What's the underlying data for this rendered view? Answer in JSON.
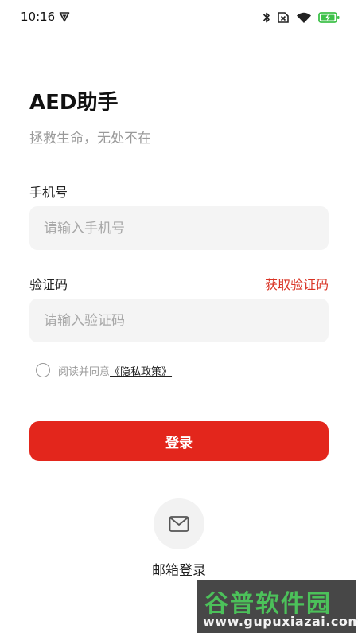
{
  "status_bar": {
    "time": "10:16",
    "icons": [
      "app-shield-icon",
      "bluetooth-icon",
      "no-sim-icon",
      "wifi-icon",
      "battery-charging-icon"
    ],
    "battery_color": "#3ec14a"
  },
  "header": {
    "title": "AED助手",
    "slogan": "拯救生命，无处不在"
  },
  "form": {
    "phone_label": "手机号",
    "phone_placeholder": "请输入手机号",
    "phone_value": "",
    "code_label": "验证码",
    "code_placeholder": "请输入验证码",
    "code_value": "",
    "get_code_label": "获取验证码",
    "agree_text": "阅读并同意",
    "privacy_link": "《隐私政策》",
    "agree_checked": false
  },
  "login": {
    "label": "登录"
  },
  "email_login": {
    "label": "邮箱登录",
    "icon": "mail-icon"
  },
  "watermark": {
    "title": "谷普软件园",
    "url": "www.gupuxiazai.com"
  },
  "colors": {
    "accent": "#e3261c",
    "link_red": "#d93324",
    "input_bg": "#f4f4f4",
    "muted_text": "#9a9a9a"
  }
}
